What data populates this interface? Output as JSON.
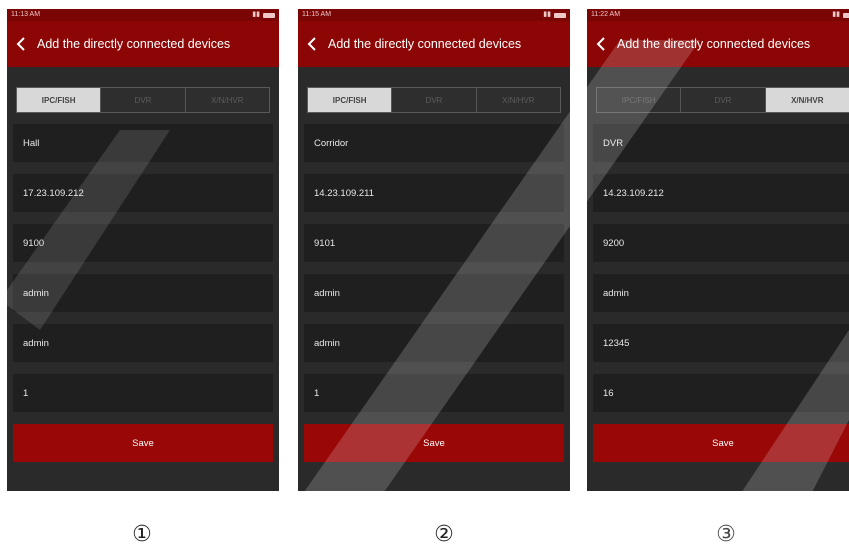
{
  "panels": [
    {
      "status_time": "11:13 AM",
      "title": "Add the directly connected devices",
      "tabs": [
        "IPC/FISH",
        "DVR",
        "X/N/HVR"
      ],
      "active_tab": 0,
      "fields": [
        "Hall",
        "17.23.109.212",
        "9100",
        "admin",
        "admin",
        "1"
      ],
      "save_label": "Save",
      "marker": "①"
    },
    {
      "status_time": "11:15 AM",
      "title": "Add the directly connected devices",
      "tabs": [
        "IPC/FISH",
        "DVR",
        "X/N/HVR"
      ],
      "active_tab": 0,
      "fields": [
        "Corridor",
        "14.23.109.211",
        "9101",
        "admin",
        "admin",
        "1"
      ],
      "save_label": "Save",
      "marker": "②"
    },
    {
      "status_time": "11:22 AM",
      "title": "Add the directly connected devices",
      "tabs": [
        "IPC/FISH",
        "DVR",
        "X/N/HVR"
      ],
      "active_tab": 2,
      "fields": [
        "DVR",
        "14.23.109.212",
        "9200",
        "admin",
        "12345",
        "16"
      ],
      "save_label": "Save",
      "marker": "③"
    }
  ],
  "colors": {
    "header": "#8c0606",
    "statusbar": "#7a0505",
    "save_button": "#9a0707",
    "background": "#2a2a2a",
    "field": "#1f1f1f"
  }
}
